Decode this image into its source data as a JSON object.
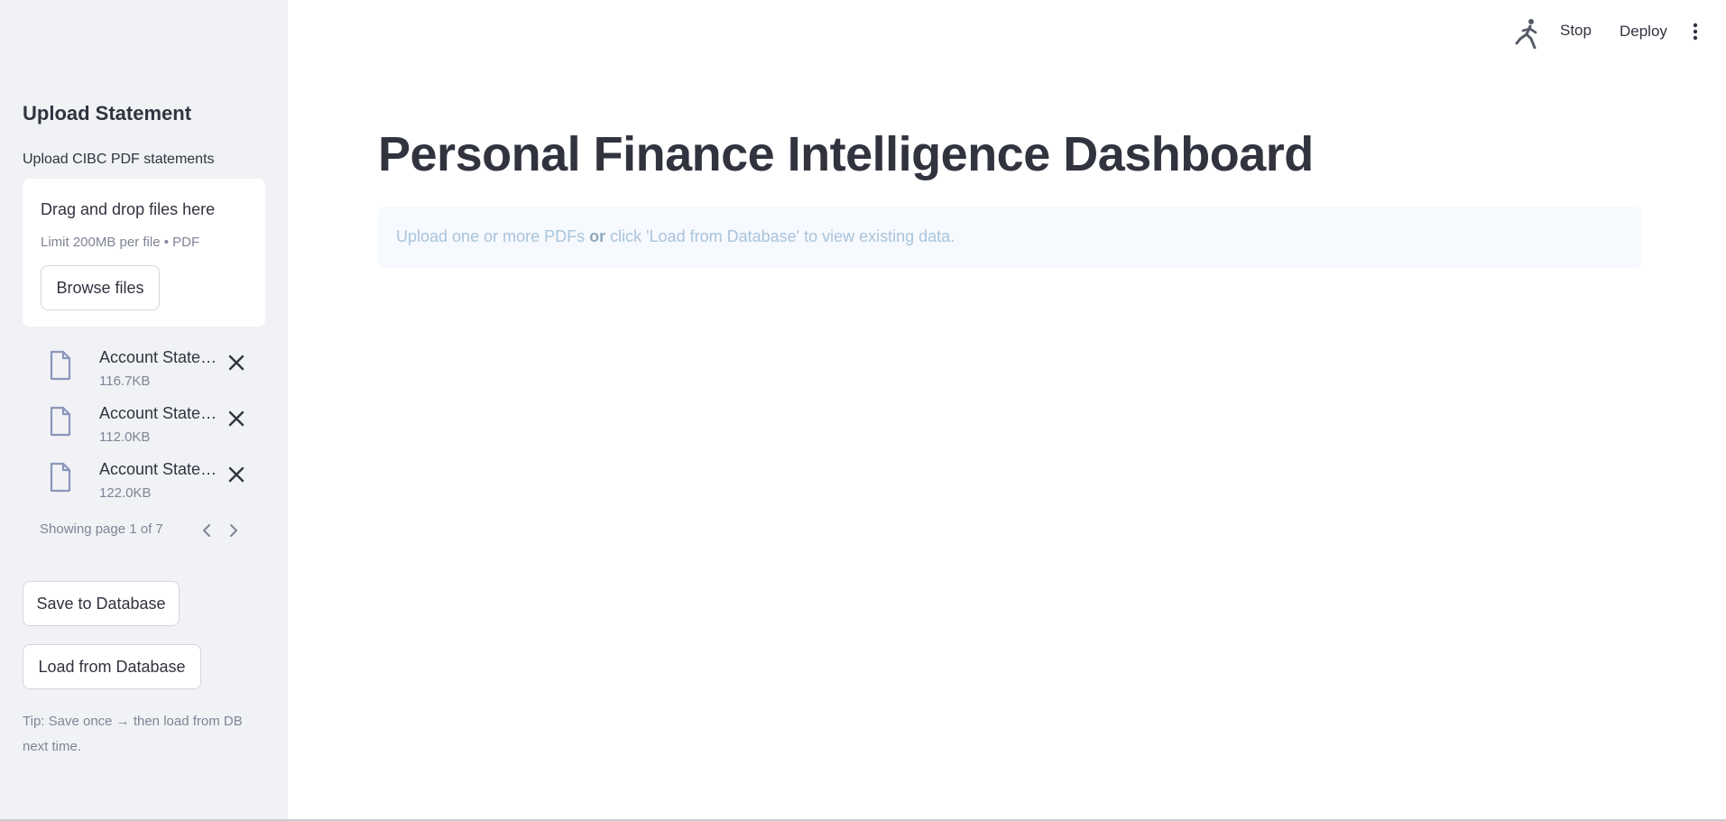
{
  "sidebar": {
    "heading": "Upload Statement",
    "uploader_label": "Upload CIBC PDF statements",
    "dropzone": {
      "title": "Drag and drop files here",
      "limit": "Limit 200MB per file • PDF",
      "browse_label": "Browse files"
    },
    "files": [
      {
        "name": "Account Statement",
        "size": "116.7KB",
        "icon": "file-icon"
      },
      {
        "name": "Account Statement",
        "size": "112.0KB",
        "icon": "file-icon"
      },
      {
        "name": "Account Statement",
        "size": "122.0KB",
        "icon": "file-icon"
      }
    ],
    "pagination": {
      "text": "Showing page 1 of 7",
      "current_page": 1,
      "total_pages": 7
    },
    "save_label": "Save to Database",
    "load_label": "Load from Database",
    "tip": "Tip: Save once → then load from DB next time."
  },
  "topbar": {
    "stop_label": "Stop",
    "deploy_label": "Deploy",
    "running_icon": "running-man-icon",
    "menu_icon": "kebab-menu-icon"
  },
  "main": {
    "title": "Personal Finance Intelligence Dashboard",
    "info": {
      "part1": "Upload one or more PDFs ",
      "emphasis": "or",
      "part2": " click 'Load from Database' to view existing data."
    }
  },
  "colors": {
    "sidebar_bg": "#f0f2f6",
    "text": "#31333f",
    "muted": "#808495",
    "info_bg": "#f6f9fd",
    "info_text": "#a8c4dc"
  }
}
